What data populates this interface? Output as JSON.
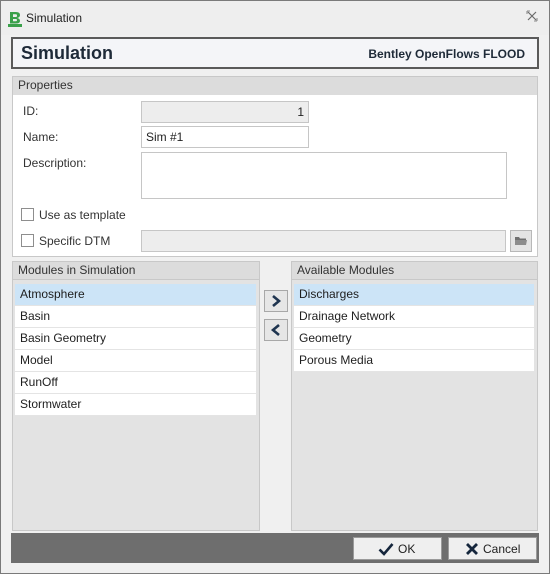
{
  "window": {
    "title": "Simulation"
  },
  "header": {
    "title": "Simulation",
    "brand": "Bentley OpenFlows FLOOD"
  },
  "properties": {
    "section_label": "Properties",
    "id_label": "ID:",
    "id_value": "1",
    "name_label": "Name:",
    "name_value": "Sim #1",
    "description_label": "Description:",
    "description_value": "",
    "use_as_template_label": "Use as template",
    "use_as_template_checked": false,
    "specific_dtm_label": "Specific DTM",
    "specific_dtm_checked": false,
    "specific_dtm_value": ""
  },
  "modules_in_simulation": {
    "label": "Modules in Simulation",
    "items": [
      "Atmosphere",
      "Basin",
      "Basin Geometry",
      "Model",
      "RunOff",
      "Stormwater"
    ],
    "selected": "Atmosphere"
  },
  "available_modules": {
    "label": "Available Modules",
    "items": [
      "Discharges",
      "Drainage Network",
      "Geometry",
      "Porous Media"
    ],
    "selected": "Discharges"
  },
  "footer": {
    "ok_label": "OK",
    "cancel_label": "Cancel"
  },
  "icons": {
    "app": "app-logo-icon",
    "close": "close-icon",
    "folder": "folder-icon",
    "add": "chevron-right-icon",
    "remove": "chevron-left-icon",
    "ok": "checkmark-icon",
    "cancel": "x-icon"
  },
  "colors": {
    "selection": "#cce4f7",
    "footer_bar": "#6e6e6e",
    "header_text": "#1e2a38",
    "app_icon_green": "#3aa04a"
  }
}
